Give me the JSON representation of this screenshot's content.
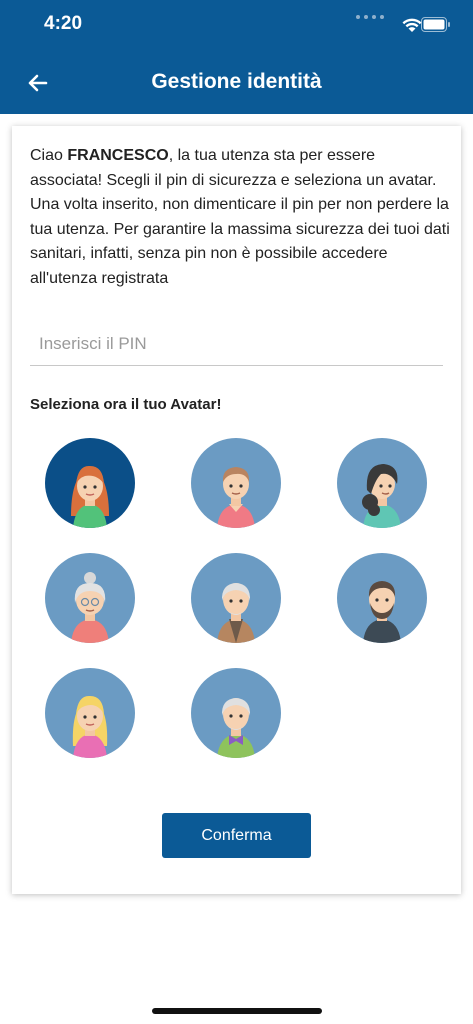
{
  "status_bar": {
    "time": "4:20"
  },
  "header": {
    "title": "Gestione identità"
  },
  "intro": {
    "greeting": "Ciao ",
    "user_name": "FRANCESCO",
    "text": ", la tua utenza sta per essere associata! Scegli il pin di sicurezza e seleziona un avatar. Una volta inserito, non dimenticare il pin per non perdere la tua utenza. Per garantire la massima sicurezza dei tuoi dati sanitari, infatti, senza pin non è possibile accedere all'utenza registrata"
  },
  "pin": {
    "placeholder": "Inserisci il PIN",
    "value": ""
  },
  "avatar_section": {
    "heading": "Seleziona ora il tuo Avatar!",
    "selected_index": 0,
    "avatars": [
      "young-woman-red-hair-avatar",
      "young-man-avatar",
      "woman-dark-hair-avatar",
      "elderly-woman-avatar",
      "elderly-man-avatar",
      "bearded-man-avatar",
      "blonde-girl-avatar",
      "elderly-man-bowtie-avatar"
    ]
  },
  "actions": {
    "confirm_label": "Conferma"
  },
  "colors": {
    "primary": "#0b5a96",
    "avatar_bg": "#6b9bc3",
    "avatar_selected_bg": "#0b4f88"
  }
}
